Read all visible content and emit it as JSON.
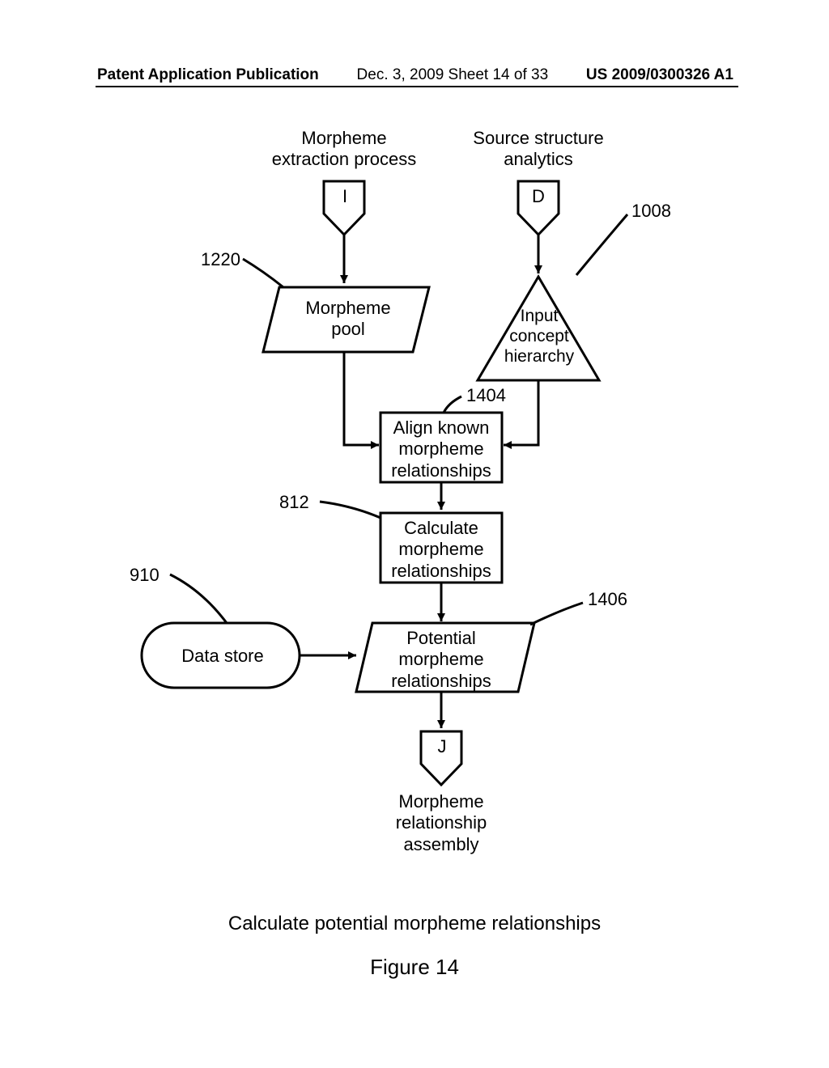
{
  "header": {
    "left": "Patent Application Publication",
    "center": "Dec. 3, 2009  Sheet 14 of 33",
    "right": "US 2009/0300326 A1"
  },
  "nodes": {
    "morpheme_extraction_process": "Morpheme\nextraction process",
    "source_structure_analytics": "Source structure\nanalytics",
    "I": "I",
    "D": "D",
    "morpheme_pool": "Morpheme\npool",
    "input_concept_hierarchy": "Input\nconcept\nhierarchy",
    "align_known": "Align known\nmorpheme\nrelationships",
    "calculate_morpheme": "Calculate\nmorpheme\nrelationships",
    "data_store": "Data store",
    "potential_morpheme": "Potential\nmorpheme\nrelationships",
    "J": "J",
    "morpheme_relationship_assembly": "Morpheme\nrelationship\nassembly"
  },
  "refs": {
    "r1008": "1008",
    "r1220": "1220",
    "r1404": "1404",
    "r812": "812",
    "r910": "910",
    "r1406": "1406"
  },
  "caption": "Calculate potential morpheme relationships",
  "figure": "Figure 14"
}
